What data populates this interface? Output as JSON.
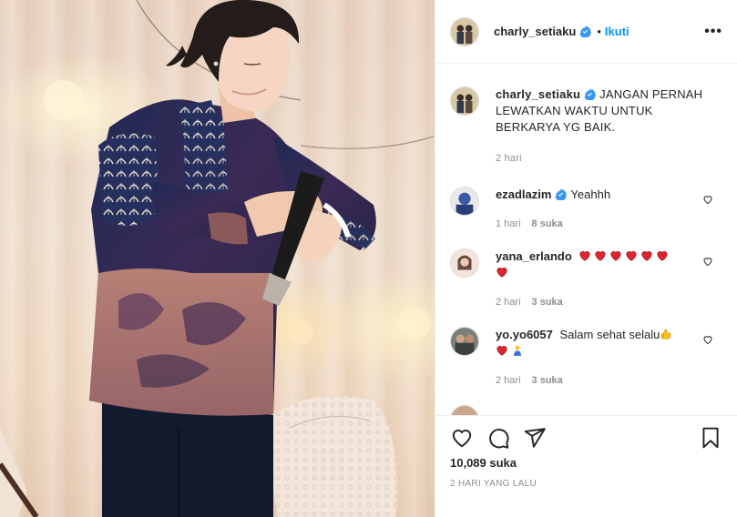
{
  "post": {
    "username": "charly_setiaku",
    "follow_separator": "•",
    "follow_label": "Ikuti",
    "more_label": "•••"
  },
  "caption": {
    "username": "charly_setiaku",
    "text": "JANGAN PERNAH LEWATKAN WAKTU UNTUK BERKARYA YG BAIK.",
    "time": "2 hari"
  },
  "comments": [
    {
      "username": "ezadlazim",
      "verified": true,
      "text": "Yeahhh",
      "time": "1 hari",
      "likes": "8 suka"
    },
    {
      "username": "yana_erlando",
      "verified": false,
      "text": "",
      "time": "2 hari",
      "likes": "3 suka"
    },
    {
      "username": "yo.yo6057",
      "verified": false,
      "text": "Salam sehat selalu",
      "time": "2 hari",
      "likes": "3 suka"
    }
  ],
  "footer": {
    "likes": "10,089 suka",
    "timestamp": "2 HARI YANG LALU"
  },
  "icons": {
    "like": "heart-outline-icon",
    "comment": "speech-bubble-icon",
    "share": "paper-plane-icon",
    "save": "bookmark-icon",
    "verified": "verified-badge-icon"
  },
  "colors": {
    "accent": "#0095f6",
    "text": "#262626",
    "muted": "#8e8e8e",
    "heart_emoji": "#e0242f"
  }
}
